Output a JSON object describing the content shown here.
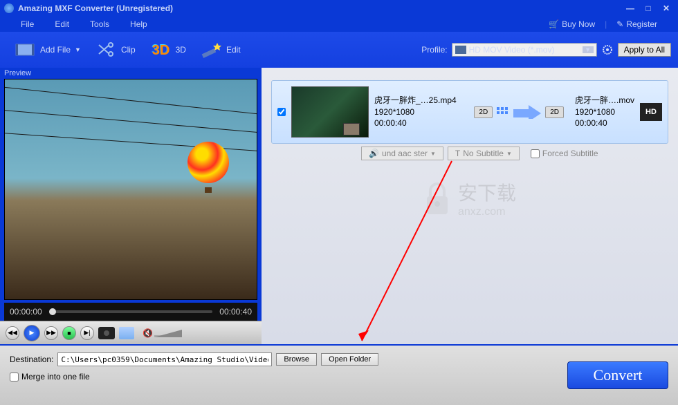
{
  "window": {
    "title": "Amazing MXF Converter (Unregistered)"
  },
  "menubar": {
    "file": "File",
    "edit": "Edit",
    "tools": "Tools",
    "help": "Help",
    "buy_now": "Buy Now",
    "register": "Register"
  },
  "toolbar": {
    "add_file": "Add File",
    "clip": "Clip",
    "three_d": "3D",
    "edit": "Edit",
    "profile_label": "Profile:",
    "profile_value": "HD MOV Video (*.mov)",
    "apply_all": "Apply to All"
  },
  "preview": {
    "label": "Preview",
    "time_current": "00:00:00",
    "time_total": "00:00:40"
  },
  "file_item": {
    "source": {
      "name": "虎牙一胖炸_…25.mp4",
      "resolution": "1920*1080",
      "duration": "00:00:40"
    },
    "target": {
      "name": "虎牙一胖….mov",
      "resolution": "1920*1080",
      "duration": "00:00:40"
    },
    "badge_2d_src": "2D",
    "badge_2d_dst": "2D",
    "hd_badge": "HD",
    "audio": "und aac ster",
    "no_subtitle": "No Subtitle",
    "forced_subtitle": "Forced Subtitle"
  },
  "watermark": {
    "main": "安下载",
    "sub": "anxz.com"
  },
  "footer": {
    "destination_label": "Destination:",
    "destination_value": "C:\\Users\\pc0359\\Documents\\Amazing Studio\\Video",
    "browse": "Browse",
    "open_folder": "Open Folder",
    "merge": "Merge into one file",
    "convert": "Convert"
  }
}
